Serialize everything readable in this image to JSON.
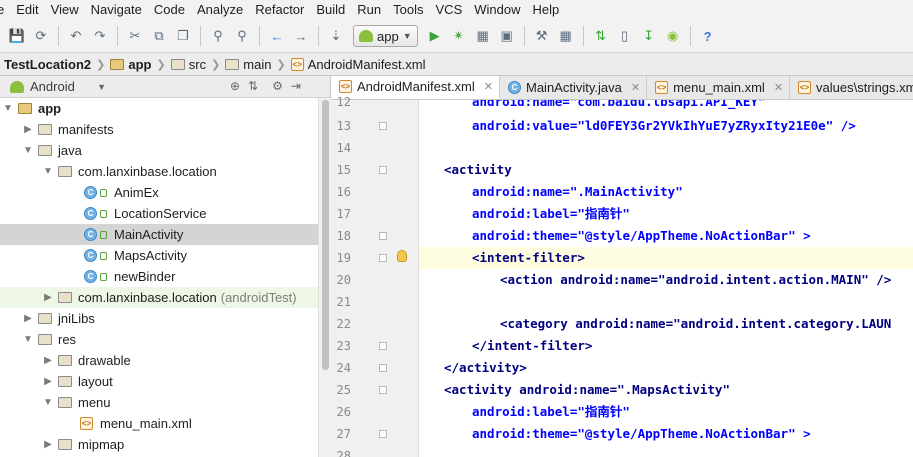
{
  "menu": [
    "e",
    "Edit",
    "View",
    "Navigate",
    "Code",
    "Analyze",
    "Refactor",
    "Build",
    "Run",
    "Tools",
    "VCS",
    "Window",
    "Help"
  ],
  "toolbar": {
    "run_config_label": "app",
    "help_label": "?"
  },
  "breadcrumbs": [
    "TestLocation2",
    "app",
    "src",
    "main",
    "AndroidManifest.xml"
  ],
  "project_panel": {
    "view_label": "Android",
    "items": [
      {
        "label": "app"
      },
      {
        "label": "manifests"
      },
      {
        "label": "java"
      },
      {
        "label": "com.lanxinbase.location"
      },
      {
        "label": "AnimEx"
      },
      {
        "label": "LocationService"
      },
      {
        "label": "MainActivity"
      },
      {
        "label": "MapsActivity"
      },
      {
        "label": "newBinder"
      },
      {
        "label": "com.lanxinbase.location",
        "suffix": "(androidTest)"
      },
      {
        "label": "jniLibs"
      },
      {
        "label": "res"
      },
      {
        "label": "drawable"
      },
      {
        "label": "layout"
      },
      {
        "label": "menu"
      },
      {
        "label": "menu_main.xml"
      },
      {
        "label": "mipmap"
      }
    ]
  },
  "editor": {
    "tabs": [
      {
        "label": "AndroidManifest.xml",
        "active": true
      },
      {
        "label": "MainActivity.java",
        "active": false
      },
      {
        "label": "menu_main.xml",
        "active": false
      },
      {
        "label": "values\\strings.xml",
        "active": false
      }
    ],
    "current_line": "19",
    "lines": [
      {
        "num": "12",
        "text": "android:name=\"com.baidu.lbsapi.API_KEY\""
      },
      {
        "num": "13",
        "text": "android:value=\"ld0FEY3Gr2YVkIhYuE7yZRyxIty21E0e\" />"
      },
      {
        "num": "14",
        "text": ""
      },
      {
        "num": "15",
        "text": "<activity"
      },
      {
        "num": "16",
        "text": "android:name=\".MainActivity\""
      },
      {
        "num": "17",
        "text": "android:label=\"指南针\""
      },
      {
        "num": "18",
        "text": "android:theme=\"@style/AppTheme.NoActionBar\" >"
      },
      {
        "num": "19",
        "text": "<intent-filter>"
      },
      {
        "num": "20",
        "text": "<action android:name=\"android.intent.action.MAIN\" />"
      },
      {
        "num": "21",
        "text": ""
      },
      {
        "num": "22",
        "text": "<category android:name=\"android.intent.category.LAUN"
      },
      {
        "num": "23",
        "text": "</intent-filter>"
      },
      {
        "num": "24",
        "text": "</activity>"
      },
      {
        "num": "25",
        "text": "<activity android:name=\".MapsActivity\""
      },
      {
        "num": "26",
        "text": "android:label=\"指南针\""
      },
      {
        "num": "27",
        "text": "android:theme=\"@style/AppTheme.NoActionBar\" >"
      },
      {
        "num": "28",
        "text": ""
      }
    ]
  },
  "colors": {
    "xml_tag": "#000080",
    "xml_attr": "#0000ff",
    "xml_string": "#008000",
    "current_line_bg": "#fffde0",
    "selected_row_bg": "#d4d4d4"
  }
}
